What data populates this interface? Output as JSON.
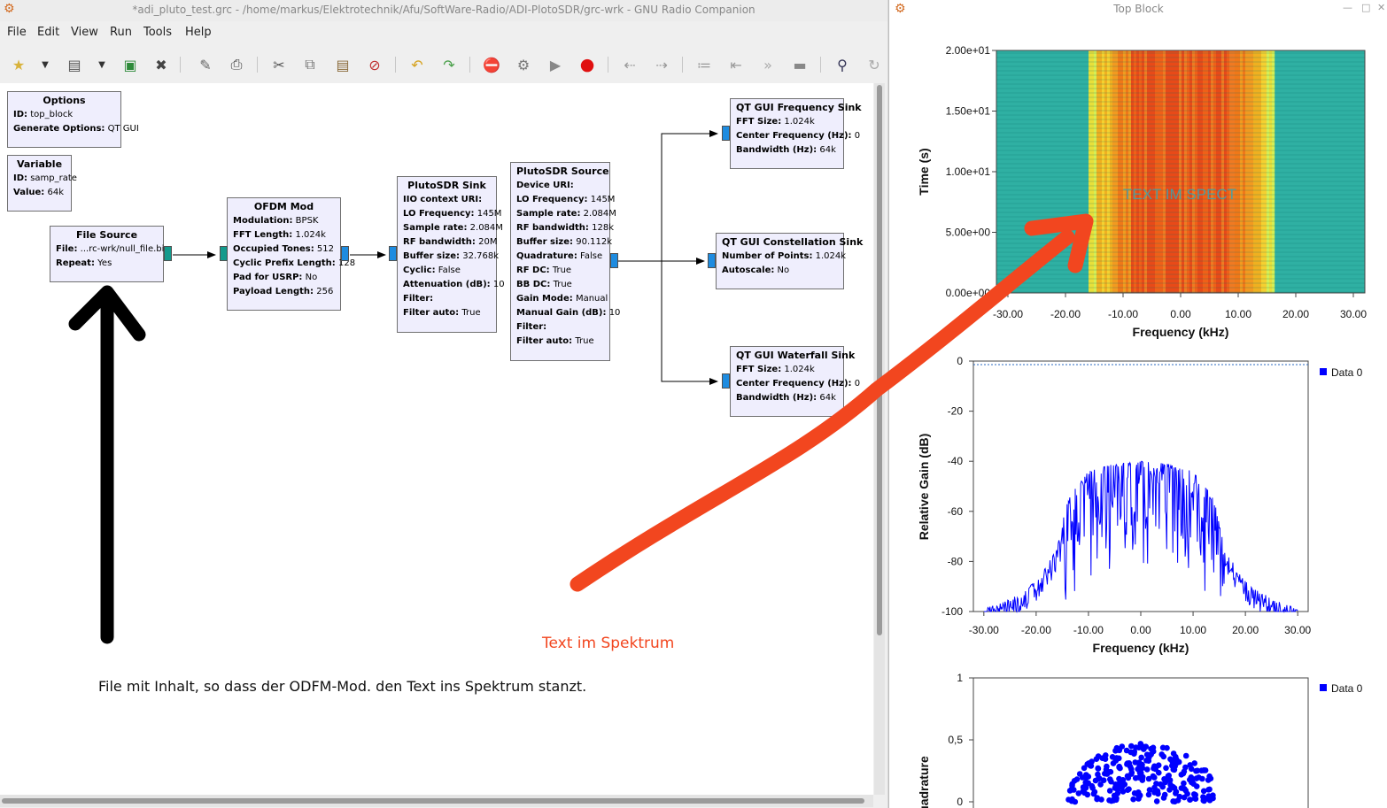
{
  "grc": {
    "title": "*adi_pluto_test.grc - /home/markus/Elektrotechnik/Afu/SoftWare-Radio/ADI-PlotoSDR/grc-wrk - GNU Radio Companion",
    "menu": [
      "File",
      "Edit",
      "View",
      "Run",
      "Tools",
      "Help"
    ],
    "blocks": {
      "options": {
        "title": "Options",
        "rows": [
          {
            "k": "ID:",
            "v": "top_block"
          },
          {
            "k": "Generate Options:",
            "v": "QT GUI"
          }
        ]
      },
      "variable": {
        "title": "Variable",
        "rows": [
          {
            "k": "ID:",
            "v": "samp_rate"
          },
          {
            "k": "Value:",
            "v": "64k"
          }
        ]
      },
      "file_source": {
        "title": "File Source",
        "rows": [
          {
            "k": "File:",
            "v": "...rc-wrk/null_file.bin"
          },
          {
            "k": "Repeat:",
            "v": "Yes"
          }
        ]
      },
      "ofdm_mod": {
        "title": "OFDM Mod",
        "rows": [
          {
            "k": "Modulation:",
            "v": "BPSK"
          },
          {
            "k": "FFT Length:",
            "v": "1.024k"
          },
          {
            "k": "Occupied Tones:",
            "v": "512"
          },
          {
            "k": "Cyclic Prefix Length:",
            "v": "128"
          },
          {
            "k": "Pad for USRP:",
            "v": "No"
          },
          {
            "k": "Payload Length:",
            "v": "256"
          }
        ]
      },
      "pluto_sink": {
        "title": "PlutoSDR Sink",
        "rows": [
          {
            "k": "IIO context URI:",
            "v": ""
          },
          {
            "k": "LO Frequency:",
            "v": "145M"
          },
          {
            "k": "Sample rate:",
            "v": "2.084M"
          },
          {
            "k": "RF bandwidth:",
            "v": "20M"
          },
          {
            "k": "Buffer size:",
            "v": "32.768k"
          },
          {
            "k": "Cyclic:",
            "v": "False"
          },
          {
            "k": "Attenuation (dB):",
            "v": "10"
          },
          {
            "k": "Filter:",
            "v": ""
          },
          {
            "k": "Filter auto:",
            "v": "True"
          }
        ]
      },
      "pluto_source": {
        "title": "PlutoSDR Source",
        "rows": [
          {
            "k": "Device URI:",
            "v": ""
          },
          {
            "k": "LO Frequency:",
            "v": "145M"
          },
          {
            "k": "Sample rate:",
            "v": "2.084M"
          },
          {
            "k": "RF bandwidth:",
            "v": "128k"
          },
          {
            "k": "Buffer size:",
            "v": "90.112k"
          },
          {
            "k": "Quadrature:",
            "v": "False"
          },
          {
            "k": "RF DC:",
            "v": "True"
          },
          {
            "k": "BB DC:",
            "v": "True"
          },
          {
            "k": "Gain Mode:",
            "v": "Manual"
          },
          {
            "k": "Manual Gain (dB):",
            "v": "10"
          },
          {
            "k": "Filter:",
            "v": ""
          },
          {
            "k": "Filter auto:",
            "v": "True"
          }
        ]
      },
      "freq_sink": {
        "title": "QT GUI Frequency Sink",
        "rows": [
          {
            "k": "FFT Size:",
            "v": "1.024k"
          },
          {
            "k": "Center Frequency (Hz):",
            "v": "0"
          },
          {
            "k": "Bandwidth (Hz):",
            "v": "64k"
          }
        ]
      },
      "const_sink": {
        "title": "QT GUI Constellation Sink",
        "rows": [
          {
            "k": "Number of Points:",
            "v": "1.024k"
          },
          {
            "k": "Autoscale:",
            "v": "No"
          }
        ]
      },
      "waterfall_sink": {
        "title": "QT GUI Waterfall Sink",
        "rows": [
          {
            "k": "FFT Size:",
            "v": "1.024k"
          },
          {
            "k": "Center Frequency (Hz):",
            "v": "0"
          },
          {
            "k": "Bandwidth (Hz):",
            "v": "64k"
          }
        ]
      }
    },
    "note_file": "File mit Inhalt, so dass der ODFM-Mod. den Text ins Spektrum stanzt.",
    "note_spectrum": "Text im Spektrum",
    "colors": {
      "annotation_red": "#f2461f",
      "block_bg": "#efeefd",
      "port_teal": "#139a8c",
      "port_blue": "#1e8ce0"
    }
  },
  "plot_window": {
    "title": "Top Block",
    "spectrum_text": "TEXT IM SPECT"
  },
  "chart_data": [
    {
      "type": "heatmap",
      "title": "",
      "xlabel": "Frequency (kHz)",
      "ylabel": "Time (s)",
      "xlim": [
        -32,
        32
      ],
      "ylim": [
        0,
        20
      ],
      "xticks": [
        "-30.00",
        "-20.00",
        "-10.00",
        "0.00",
        "10.00",
        "20.00",
        "30.00"
      ],
      "yticks": [
        "0.00e+00",
        "5.00e+00",
        "1.00e+01",
        "1.50e+01",
        "2.00e+01"
      ],
      "occupied_band_khz": [
        -16,
        16
      ]
    },
    {
      "type": "line",
      "title": "",
      "xlabel": "Frequency (kHz)",
      "ylabel": "Relative Gain (dB)",
      "xlim": [
        -32,
        32
      ],
      "ylim": [
        -100,
        0
      ],
      "xticks": [
        "-30.00",
        "-20.00",
        "-10.00",
        "0.00",
        "10.00",
        "20.00",
        "30.00"
      ],
      "yticks": [
        "0",
        "-20",
        "-40",
        "-60",
        "-80",
        "-100"
      ],
      "legend": "top-right",
      "series": [
        {
          "name": "Data 0",
          "color": "#0000ff"
        }
      ],
      "envelope": {
        "x": [
          -30,
          -25,
          -20,
          -16,
          -14,
          -10,
          -5,
          0,
          5,
          10,
          14,
          16,
          20,
          25,
          30
        ],
        "y": [
          -99,
          -95,
          -88,
          -75,
          -55,
          -44,
          -41,
          -40,
          -41,
          -44,
          -55,
          -75,
          -88,
          -95,
          -99
        ]
      }
    },
    {
      "type": "scatter",
      "title": "",
      "ylabel": "Quadrature",
      "ylim": [
        -1,
        1
      ],
      "yticks": [
        "1",
        "0,5",
        "0"
      ],
      "legend": "top-right",
      "series": [
        {
          "name": "Data 0",
          "color": "#0000ff"
        }
      ]
    }
  ]
}
